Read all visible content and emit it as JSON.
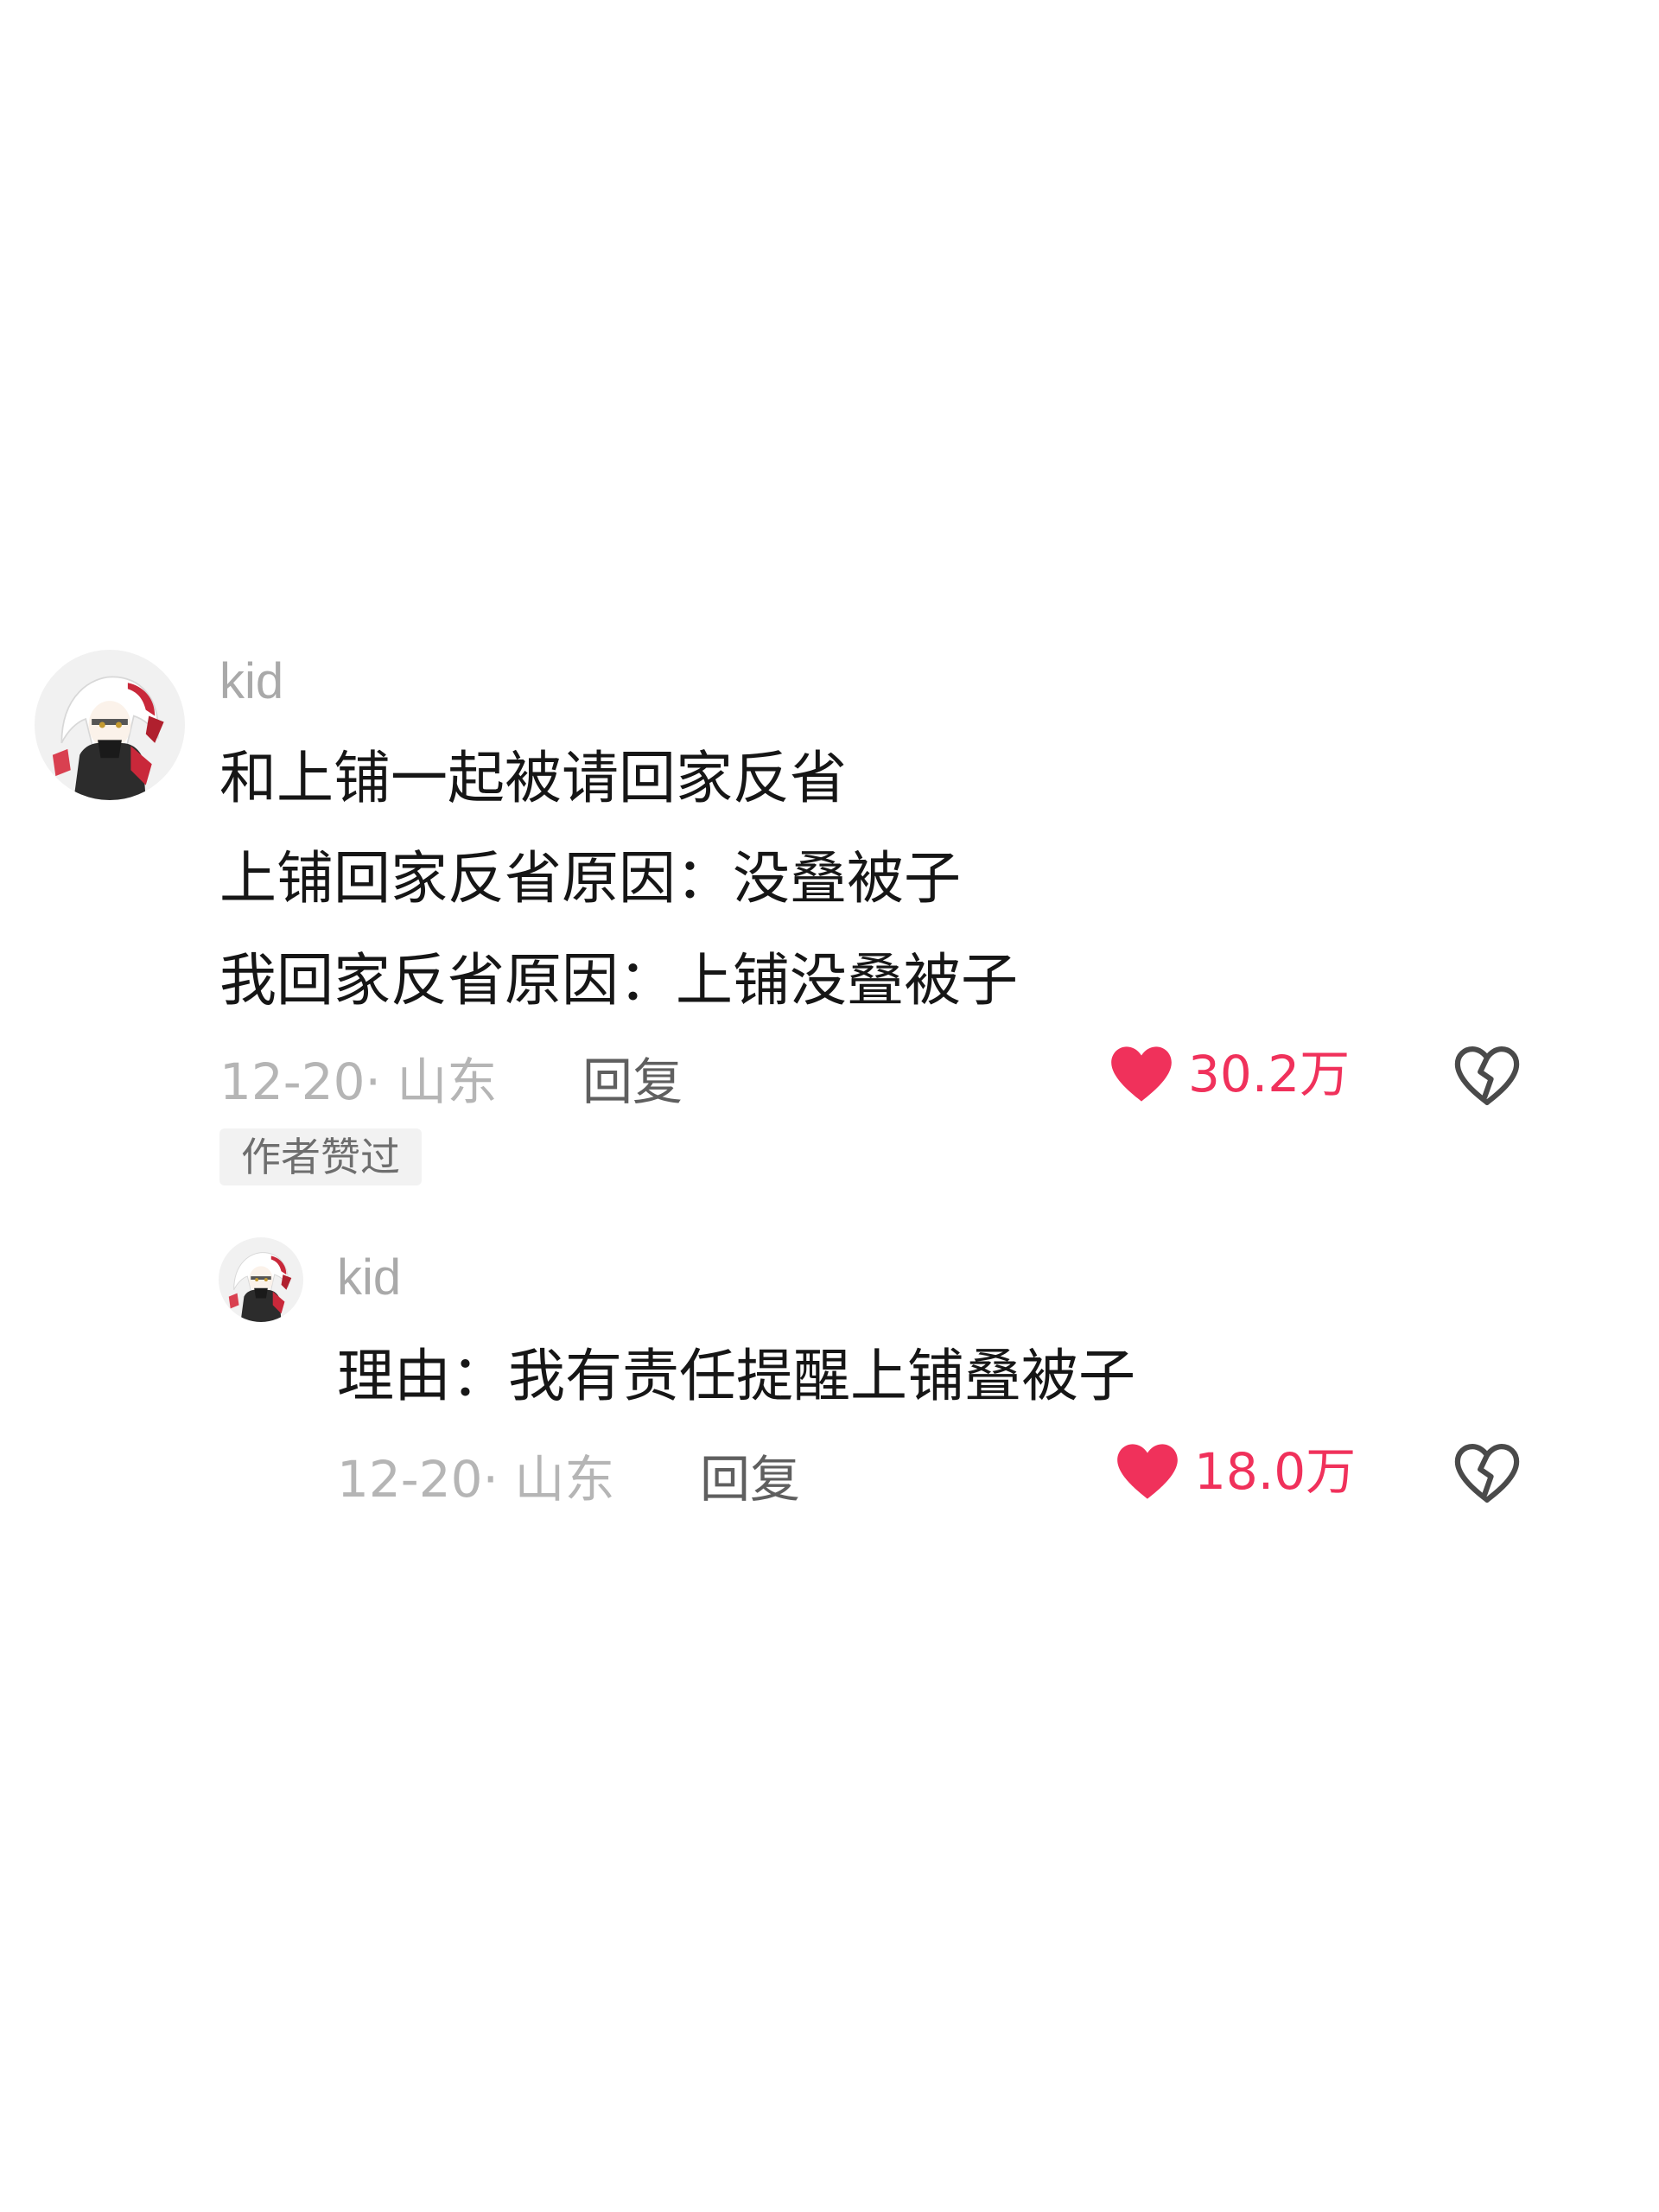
{
  "comment": {
    "username": "kid",
    "lines": [
      "和上铺一起被请回家反省",
      "上铺回家反省原因：没叠被子",
      "我回家反省原因：上铺没叠被子"
    ],
    "meta": "12-20· 山东",
    "reply_label": "回复",
    "like_count": "30.2万",
    "author_badge": "作者赞过"
  },
  "reply": {
    "username": "kid",
    "text": "理由：我有责任提醒上铺叠被子",
    "meta": "12-20· 山东",
    "reply_label": "回复",
    "like_count": "18.0万"
  },
  "colors": {
    "like": "#f0315b",
    "muted_text": "#b5b5b5",
    "username": "#a9a9a9",
    "body_text": "#161616",
    "badge_bg": "#f2f2f2"
  },
  "icons": {
    "like": "heart-icon",
    "dislike": "broken-heart-icon",
    "avatar": "avatar"
  }
}
